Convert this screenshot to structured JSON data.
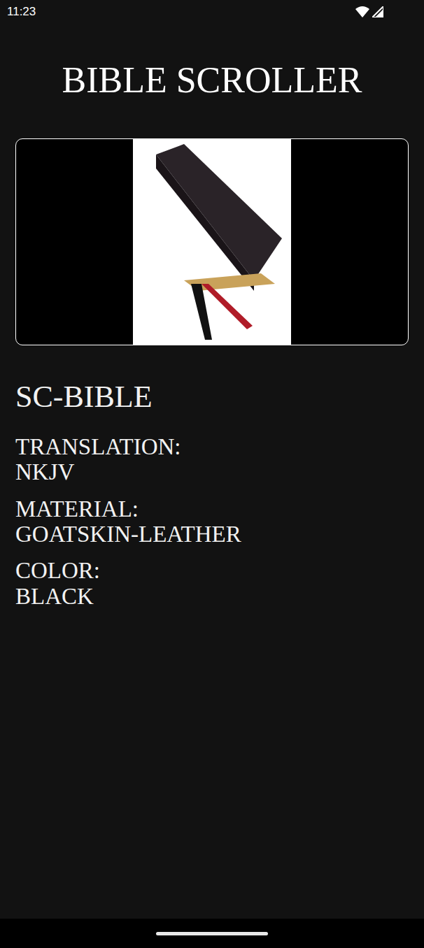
{
  "status_bar": {
    "time": "11:23"
  },
  "app": {
    "title": "BIBLE SCROLLER"
  },
  "product": {
    "name": "SC-BIBLE",
    "attributes": [
      {
        "label": "TRANSLATION:",
        "value": "NKJV"
      },
      {
        "label": "MATERIAL:",
        "value": "GOATSKIN-LEATHER"
      },
      {
        "label": "COLOR:",
        "value": "BLACK"
      }
    ]
  }
}
